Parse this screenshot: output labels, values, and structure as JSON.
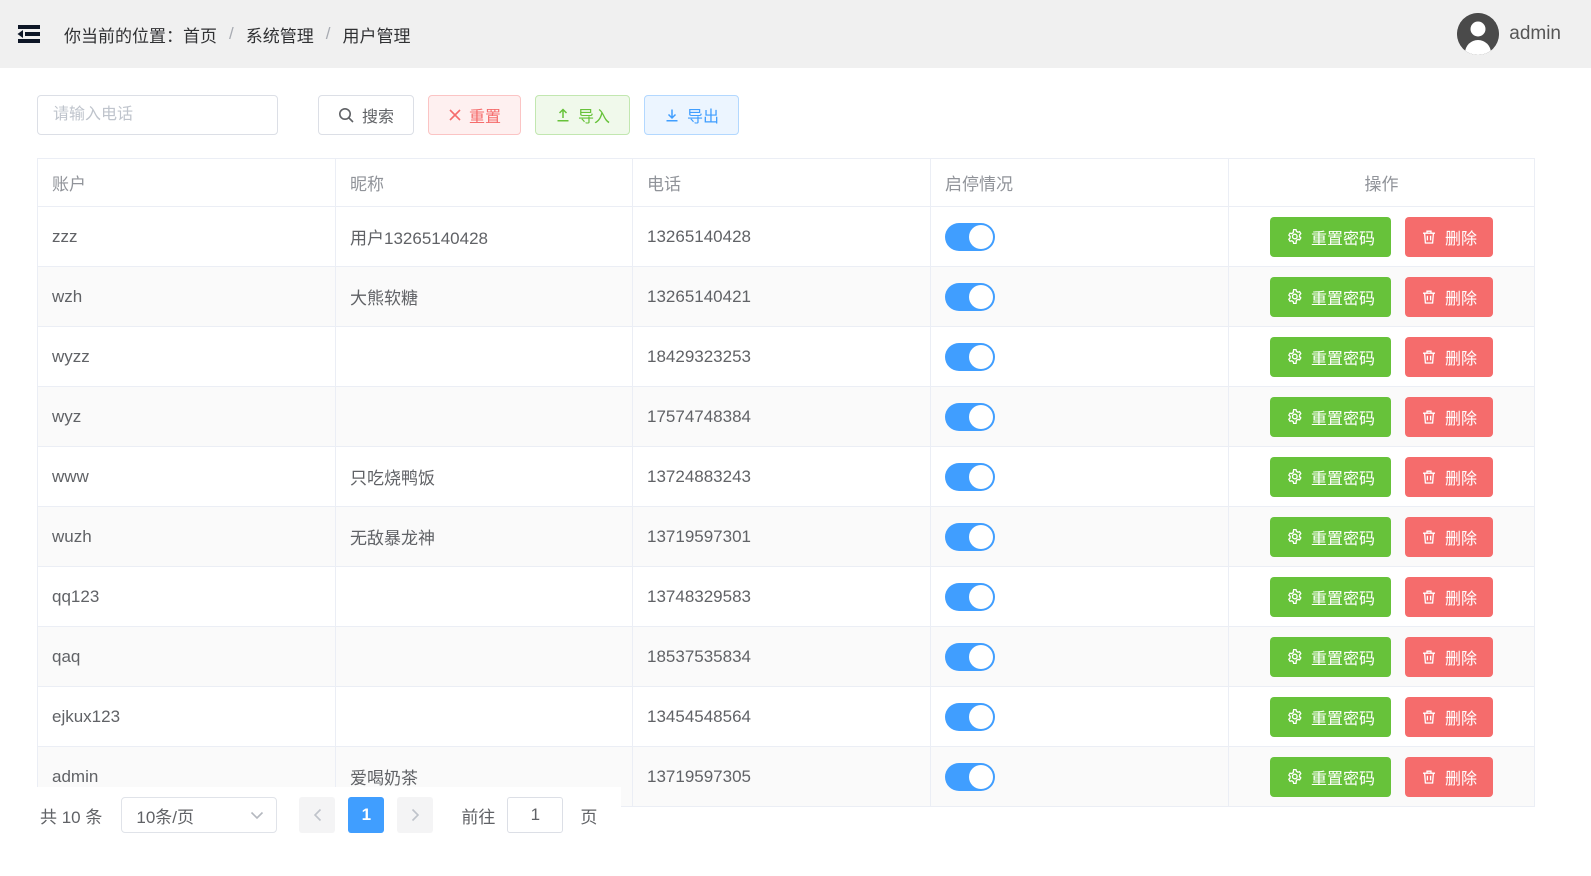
{
  "header": {
    "breadcrumb_label": "你当前的位置：",
    "breadcrumb": [
      "首页",
      "系统管理",
      "用户管理"
    ],
    "separator": "/",
    "username": "admin"
  },
  "toolbar": {
    "search_placeholder": "请输入电话",
    "search_label": "搜索",
    "reset_label": "重置",
    "import_label": "导入",
    "export_label": "导出"
  },
  "table": {
    "columns": [
      "账户",
      "昵称",
      "电话",
      "启停情况",
      "操作"
    ],
    "reset_pwd_label": "重置密码",
    "delete_label": "删除",
    "rows": [
      {
        "account": "zzz",
        "nickname": "用户13265140428",
        "phone": "13265140428",
        "enabled": true
      },
      {
        "account": "wzh",
        "nickname": "大熊软糖",
        "phone": "13265140421",
        "enabled": true
      },
      {
        "account": "wyzz",
        "nickname": "",
        "phone": "18429323253",
        "enabled": true
      },
      {
        "account": "wyz",
        "nickname": "",
        "phone": "17574748384",
        "enabled": true
      },
      {
        "account": "www",
        "nickname": "只吃烧鸭饭",
        "phone": "13724883243",
        "enabled": true
      },
      {
        "account": "wuzh",
        "nickname": "无敌暴龙神",
        "phone": "13719597301",
        "enabled": true
      },
      {
        "account": "qq123",
        "nickname": "",
        "phone": "13748329583",
        "enabled": true
      },
      {
        "account": "qaq",
        "nickname": "",
        "phone": "18537535834",
        "enabled": true
      },
      {
        "account": "ejkux123",
        "nickname": "",
        "phone": "13454548564",
        "enabled": true
      },
      {
        "account": "admin",
        "nickname": "爱喝奶茶",
        "phone": "13719597305",
        "enabled": true
      }
    ]
  },
  "pagination": {
    "total_label": "共 10 条",
    "page_size_label": "10条/页",
    "current_page": "1",
    "goto_label": "前往",
    "goto_value": "1",
    "page_word": "页"
  },
  "colors": {
    "primary": "#409eff",
    "success": "#67c23a",
    "danger": "#f56c6c",
    "topbar_bg": "#f0f0f0",
    "table_border": "#ebeef5",
    "stripe_bg": "#fafafa",
    "header_text": "#909399",
    "cell_text": "#606266"
  }
}
